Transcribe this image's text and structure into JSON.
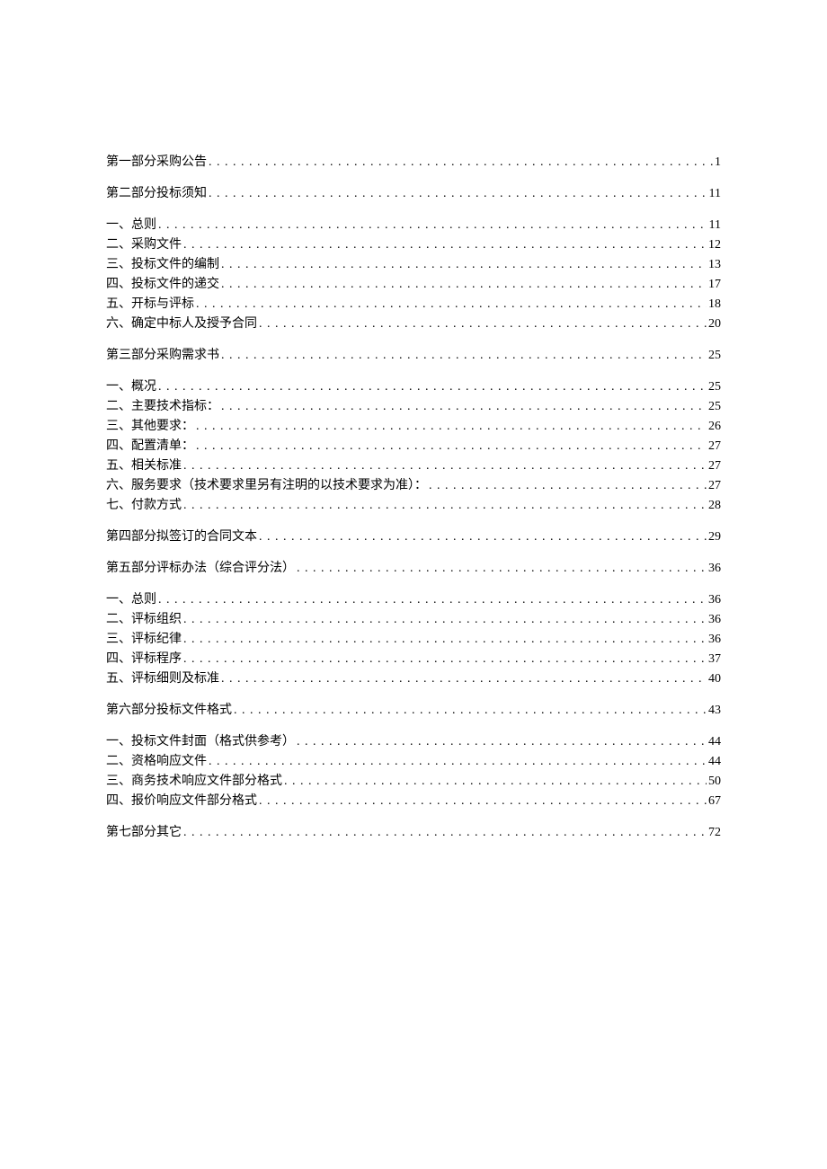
{
  "toc": [
    {
      "label": "第一部分采购公告",
      "page": "1",
      "type": "head",
      "first": true
    },
    {
      "label": "第二部分投标须知",
      "page": "11",
      "type": "head"
    },
    {
      "label": "一、总则",
      "page": "11",
      "type": "sub"
    },
    {
      "label": "二、采购文件",
      "page": "12",
      "type": "sub"
    },
    {
      "label": "三、投标文件的编制",
      "page": "13",
      "type": "sub"
    },
    {
      "label": "四、投标文件的递交",
      "page": "17",
      "type": "sub"
    },
    {
      "label": "五、开标与评标",
      "page": "18",
      "type": "sub"
    },
    {
      "label": "六、确定中标人及授予合同",
      "page": "20",
      "type": "sub"
    },
    {
      "label": "第三部分采购需求书",
      "page": "25",
      "type": "head"
    },
    {
      "label": "一、概况",
      "page": "25",
      "type": "sub"
    },
    {
      "label": "二、主要技术指标：",
      "page": "25",
      "type": "sub"
    },
    {
      "label": "三、其他要求：",
      "page": "26",
      "type": "sub"
    },
    {
      "label": "四、配置清单：",
      "page": "27",
      "type": "sub"
    },
    {
      "label": "五、相关标准",
      "page": "27",
      "type": "sub"
    },
    {
      "label": "六、服务要求（技术要求里另有注明的以技术要求为准）：",
      "page": "27",
      "type": "sub"
    },
    {
      "label": "七、付款方式",
      "page": "28",
      "type": "sub"
    },
    {
      "label": "第四部分拟签订的合同文本",
      "page": "29",
      "type": "head"
    },
    {
      "label": "第五部分评标办法（综合评分法）",
      "page": "36",
      "type": "head"
    },
    {
      "label": "一、总则",
      "page": "36",
      "type": "sub"
    },
    {
      "label": "二、评标组织",
      "page": "36",
      "type": "sub"
    },
    {
      "label": "三、评标纪律",
      "page": "36",
      "type": "sub"
    },
    {
      "label": "四、评标程序",
      "page": "37",
      "type": "sub"
    },
    {
      "label": "五、评标细则及标准",
      "page": "40",
      "type": "sub"
    },
    {
      "label": "第六部分投标文件格式",
      "page": "43",
      "type": "head"
    },
    {
      "label": "一、投标文件封面（格式供参考）",
      "page": "44",
      "type": "sub"
    },
    {
      "label": "二、资格响应文件",
      "page": "44",
      "type": "sub"
    },
    {
      "label": "三、商务技术响应文件部分格式",
      "page": "50",
      "type": "sub"
    },
    {
      "label": "四、报价响应文件部分格式",
      "page": "67",
      "type": "sub"
    },
    {
      "label": "第七部分其它",
      "page": "72",
      "type": "head"
    }
  ]
}
